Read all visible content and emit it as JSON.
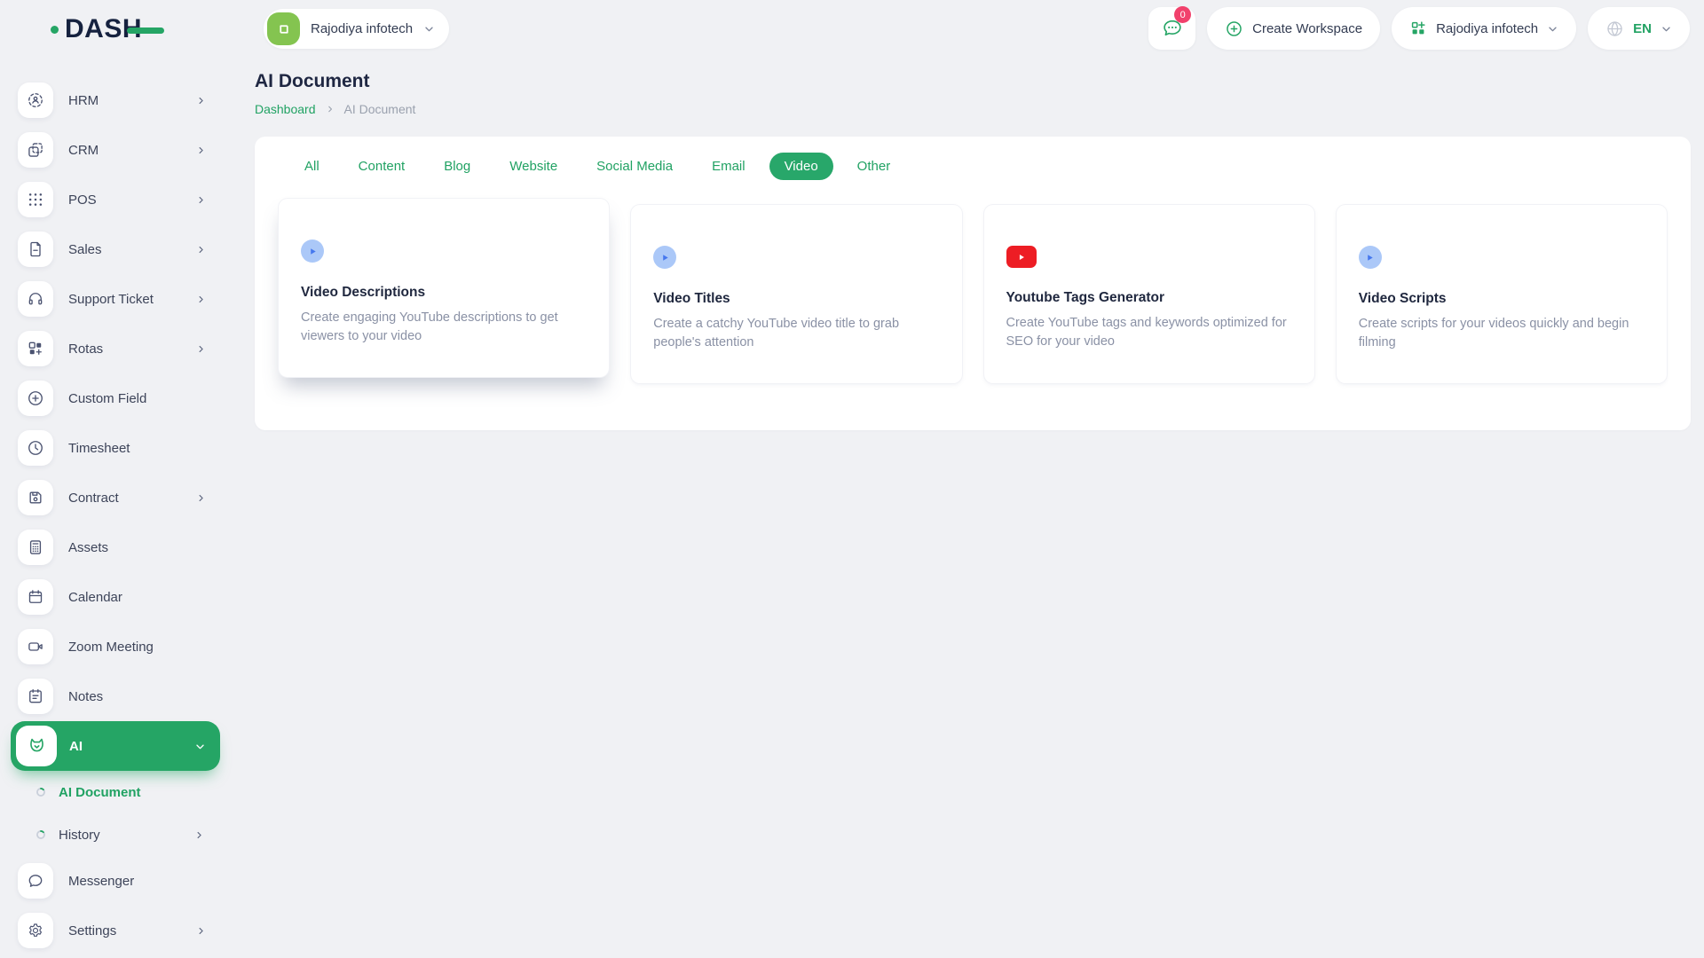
{
  "colors": {
    "accent_green": "#25a565",
    "accent_text_green": "#21a263",
    "avatar_green": "#84c450",
    "badge_pink": "#f1416c",
    "youtube_red": "#ed1d24",
    "play_blue": "#4577ee",
    "play_blue_bg": "#abc8f8"
  },
  "header": {
    "logo_text": "DASH",
    "workspace_selector": {
      "label": "Rajodiya infotech",
      "icon": "workspace-avatar-icon"
    },
    "messages": {
      "icon": "chat-icon",
      "badge_count": "0"
    },
    "create_workspace": {
      "label": "Create Workspace",
      "icon": "plus-circle-icon"
    },
    "company_selector": {
      "label": "Rajodiya infotech",
      "icon": "org-grid-icon"
    },
    "language_selector": {
      "label": "EN",
      "icon": "globe-icon"
    }
  },
  "sidebar": {
    "items": [
      {
        "id": "hrm",
        "label": "HRM",
        "icon": "hrm-icon",
        "chevron": "right"
      },
      {
        "id": "crm",
        "label": "CRM",
        "icon": "crm-icon",
        "chevron": "right"
      },
      {
        "id": "pos",
        "label": "POS",
        "icon": "pos-icon",
        "chevron": "right"
      },
      {
        "id": "sales",
        "label": "Sales",
        "icon": "sales-icon",
        "chevron": "right"
      },
      {
        "id": "support-ticket",
        "label": "Support Ticket",
        "icon": "support-ticket-icon",
        "chevron": "right"
      },
      {
        "id": "rotas",
        "label": "Rotas",
        "icon": "rotas-icon",
        "chevron": "right"
      },
      {
        "id": "custom-field",
        "label": "Custom Field",
        "icon": "custom-field-icon",
        "chevron": null
      },
      {
        "id": "timesheet",
        "label": "Timesheet",
        "icon": "timesheet-icon",
        "chevron": null
      },
      {
        "id": "contract",
        "label": "Contract",
        "icon": "contract-icon",
        "chevron": "right"
      },
      {
        "id": "assets",
        "label": "Assets",
        "icon": "assets-icon",
        "chevron": null
      },
      {
        "id": "calendar",
        "label": "Calendar",
        "icon": "calendar-icon",
        "chevron": null
      },
      {
        "id": "zoom-meeting",
        "label": "Zoom Meeting",
        "icon": "zoom-meeting-icon",
        "chevron": null
      },
      {
        "id": "notes",
        "label": "Notes",
        "icon": "notes-icon",
        "chevron": null
      },
      {
        "id": "ai",
        "label": "AI",
        "icon": "ai-fox-icon",
        "chevron": "down",
        "active": true,
        "children": [
          {
            "id": "ai-document",
            "label": "AI Document",
            "icon": "progress-circle-icon",
            "active": true,
            "chevron": null
          },
          {
            "id": "history",
            "label": "History",
            "icon": "progress-circle-icon",
            "active": false,
            "chevron": "right"
          }
        ]
      },
      {
        "id": "messenger",
        "label": "Messenger",
        "icon": "messenger-icon",
        "chevron": null
      },
      {
        "id": "settings",
        "label": "Settings",
        "icon": "settings-icon",
        "chevron": "right"
      }
    ]
  },
  "page": {
    "title": "AI Document",
    "breadcrumb": {
      "items": [
        "Dashboard",
        "AI Document"
      ]
    }
  },
  "tabs": [
    {
      "label": "All",
      "active": false
    },
    {
      "label": "Content",
      "active": false
    },
    {
      "label": "Blog",
      "active": false
    },
    {
      "label": "Website",
      "active": false
    },
    {
      "label": "Social Media",
      "active": false
    },
    {
      "label": "Email",
      "active": false
    },
    {
      "label": "Video",
      "active": true
    },
    {
      "label": "Other",
      "active": false
    }
  ],
  "cards": [
    {
      "title": "Video Descriptions",
      "description": "Create engaging YouTube descriptions to get viewers to your video",
      "icon": "play-circle-icon",
      "hovered": true
    },
    {
      "title": "Video Titles",
      "description": "Create a catchy YouTube video title to grab people's attention",
      "icon": "play-circle-icon",
      "hovered": false
    },
    {
      "title": "Youtube Tags Generator",
      "description": "Create YouTube tags and keywords optimized for SEO for your video",
      "icon": "youtube-play-icon",
      "hovered": false
    },
    {
      "title": "Video Scripts",
      "description": "Create scripts for your videos quickly and begin filming",
      "icon": "play-circle-icon",
      "hovered": false
    }
  ]
}
